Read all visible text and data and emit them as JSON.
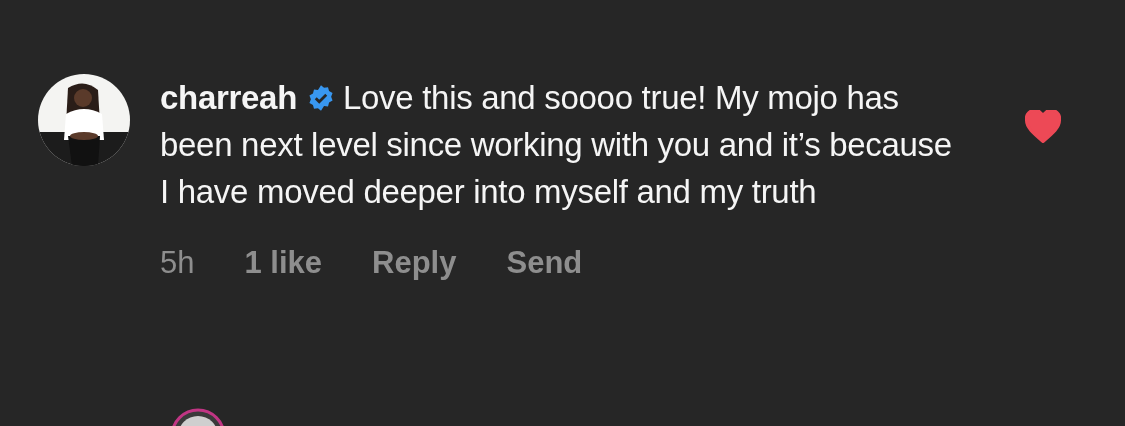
{
  "comment": {
    "username": "charreah",
    "verified": true,
    "text": "Love this and soooo true! My mojo has been next level since working with you and it’s because I have moved deeper into myself and my truth",
    "liked": true,
    "meta": [
      {
        "kind": "time",
        "label": "5h"
      },
      {
        "kind": "likes",
        "label": "1 like"
      },
      {
        "kind": "action",
        "label": "Reply"
      },
      {
        "kind": "action",
        "label": "Send"
      }
    ]
  }
}
